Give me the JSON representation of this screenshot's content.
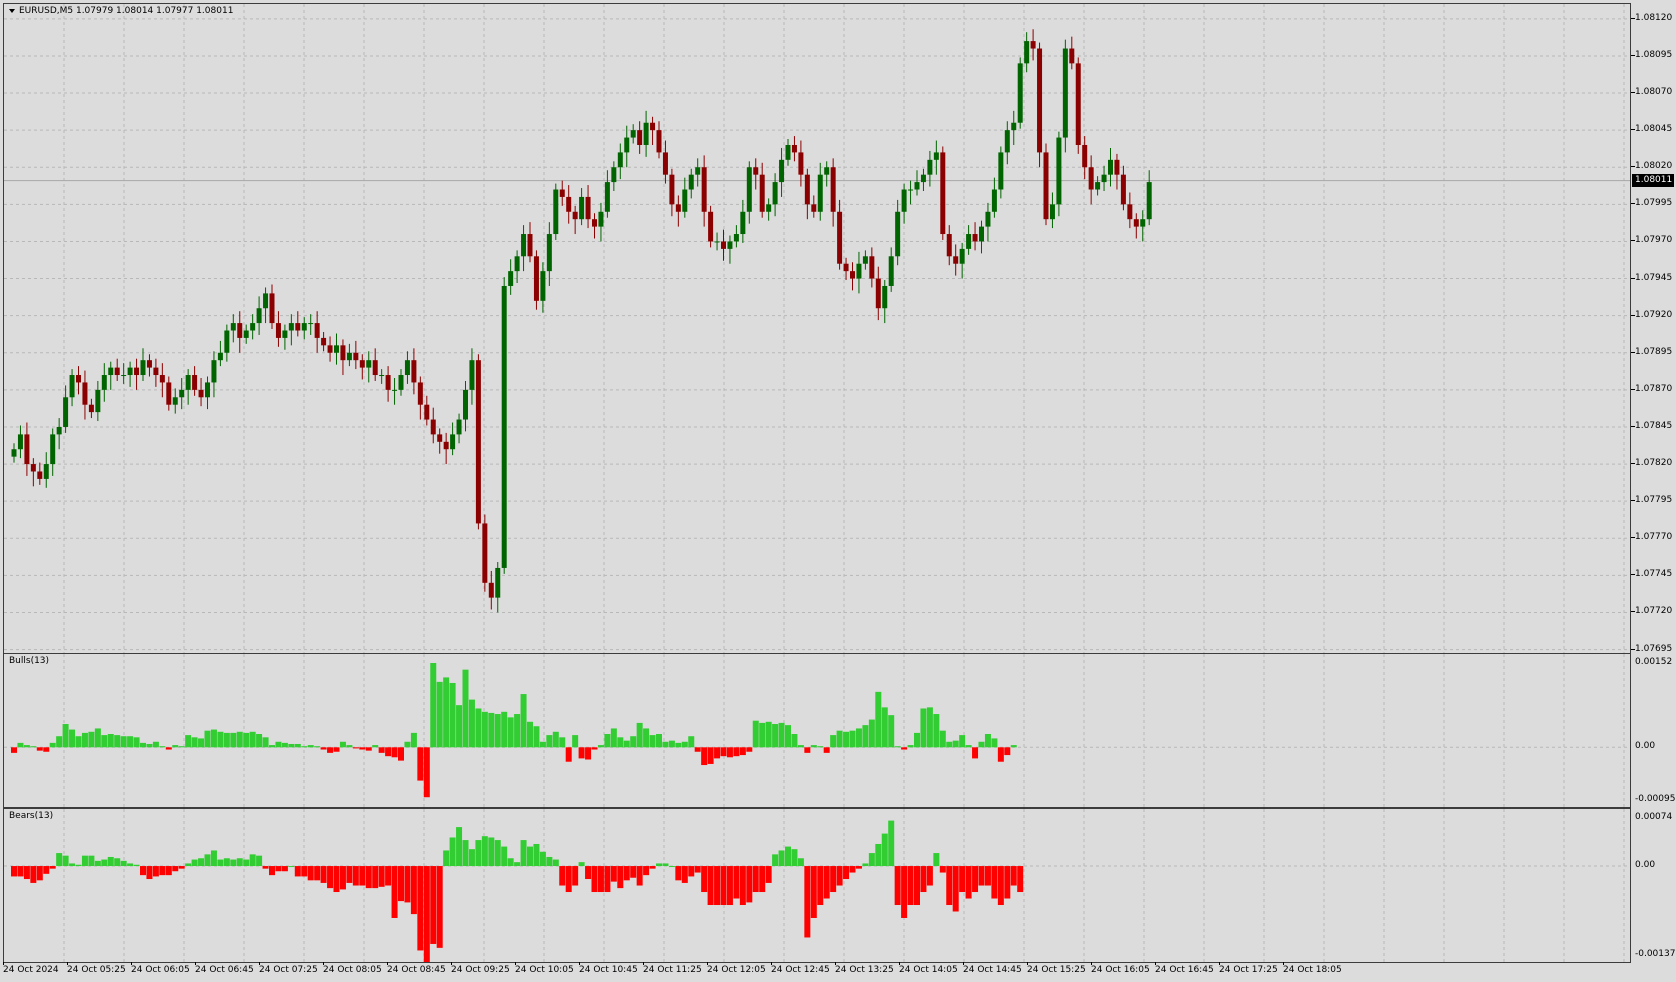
{
  "colors": {
    "background": "#dcdcdc",
    "grid": "#b8b8b8",
    "bull_candle": "#006400",
    "bear_candle": "#8b0000",
    "wick_up": "#006400",
    "wick_down": "#8b0000",
    "bulls_pos": "#32cd32",
    "bulls_neg": "#ff0000"
  },
  "main": {
    "title": "EURUSD,M5  1.07979 1.08014 1.07977 1.08011",
    "collapse_icon": "triangle-down-icon",
    "current_price": "1.08011",
    "price_ticks": [
      "1.08120",
      "1.08095",
      "1.08070",
      "1.08045",
      "1.08020",
      "1.07995",
      "1.07970",
      "1.07945",
      "1.07920",
      "1.07895",
      "1.07870",
      "1.07845",
      "1.07820",
      "1.07795",
      "1.07770",
      "1.07745",
      "1.07720",
      "1.07695"
    ]
  },
  "bulls": {
    "label": "Bulls(13)",
    "ticks": [
      "0.00152",
      "0.00",
      "-0.00095"
    ]
  },
  "bears": {
    "label": "Bears(13)",
    "ticks": [
      "0.00074",
      "0.00",
      "-0.00137"
    ]
  },
  "time_labels": [
    "24 Oct 2024",
    "24 Oct 05:25",
    "24 Oct 06:05",
    "24 Oct 06:45",
    "24 Oct 07:25",
    "24 Oct 08:05",
    "24 Oct 08:45",
    "24 Oct 09:25",
    "24 Oct 10:05",
    "24 Oct 10:45",
    "24 Oct 11:25",
    "24 Oct 12:05",
    "24 Oct 12:45",
    "24 Oct 13:25",
    "24 Oct 14:05",
    "24 Oct 14:45",
    "24 Oct 15:25",
    "24 Oct 16:05",
    "24 Oct 16:45",
    "24 Oct 17:25",
    "24 Oct 18:05"
  ],
  "chart_data": [
    {
      "type": "candlestick",
      "symbol": "EURUSD",
      "timeframe": "M5",
      "ylim": [
        1.0769,
        1.0813
      ],
      "closes": [
        1.0783,
        1.0784,
        1.0782,
        1.07815,
        1.0781,
        1.0782,
        1.0784,
        1.07845,
        1.07865,
        1.0788,
        1.07875,
        1.0786,
        1.07855,
        1.0787,
        1.0788,
        1.07885,
        1.0788,
        1.0788,
        1.07885,
        1.0788,
        1.0789,
        1.07885,
        1.0788,
        1.07875,
        1.0786,
        1.07865,
        1.0787,
        1.0788,
        1.0787,
        1.07865,
        1.07875,
        1.0789,
        1.07895,
        1.0791,
        1.07915,
        1.07905,
        1.0791,
        1.07915,
        1.07925,
        1.07935,
        1.07915,
        1.07905,
        1.0791,
        1.07915,
        1.0791,
        1.07915,
        1.07915,
        1.07905,
        1.079,
        1.07895,
        1.079,
        1.0789,
        1.07895,
        1.0789,
        1.07885,
        1.0789,
        1.0788,
        1.0788,
        1.0787,
        1.0787,
        1.0788,
        1.0789,
        1.07875,
        1.0786,
        1.0785,
        1.0784,
        1.07835,
        1.0783,
        1.0784,
        1.0785,
        1.0787,
        1.0789,
        1.0778,
        1.0774,
        1.0773,
        1.0775,
        1.0794,
        1.0795,
        1.0796,
        1.07975,
        1.0796,
        1.0793,
        1.0795,
        1.07975,
        1.08005,
        1.08,
        1.0799,
        1.07985,
        1.08,
        1.07985,
        1.0798,
        1.0799,
        1.0801,
        1.0802,
        1.0803,
        1.0804,
        1.08045,
        1.08035,
        1.0805,
        1.08045,
        1.0803,
        1.08015,
        1.07995,
        1.0799,
        1.08005,
        1.08015,
        1.0802,
        1.0799,
        1.0797,
        1.0797,
        1.07965,
        1.0797,
        1.07975,
        1.0799,
        1.0802,
        1.08015,
        1.0799,
        1.07995,
        1.0801,
        1.08025,
        1.08035,
        1.0803,
        1.08015,
        1.07995,
        1.0799,
        1.08015,
        1.0802,
        1.0799,
        1.07955,
        1.0795,
        1.07945,
        1.07955,
        1.0796,
        1.07945,
        1.07925,
        1.0794,
        1.0796,
        1.0799,
        1.08005,
        1.08005,
        1.0801,
        1.08015,
        1.08025,
        1.0803,
        1.07975,
        1.0796,
        1.07955,
        1.07965,
        1.07975,
        1.0797,
        1.0798,
        1.0799,
        1.08005,
        1.0803,
        1.08045,
        1.0805,
        1.0809,
        1.08105,
        1.081,
        1.0803,
        1.07985,
        1.07995,
        1.0804,
        1.081,
        1.0809,
        1.08035,
        1.0802,
        1.08005,
        1.0801,
        1.08015,
        1.08025,
        1.08015,
        1.07995,
        1.07985,
        1.0798,
        1.07985,
        1.0801
      ],
      "last_ohlc": {
        "open": 1.07979,
        "high": 1.08014,
        "low": 1.07977,
        "close": 1.08011
      }
    },
    {
      "type": "bar",
      "title": "Bulls(13)",
      "ylim": [
        -0.00095,
        0.00152
      ],
      "values": [
        -0.0001,
        8e-05,
        4e-05,
        2e-05,
        -6e-05,
        -8e-05,
        8e-05,
        0.0002,
        0.00042,
        0.00032,
        0.0002,
        0.00026,
        0.00028,
        0.00034,
        0.00022,
        0.00024,
        0.00022,
        0.0002,
        0.0002,
        0.00018,
        8e-05,
        6e-05,
        0.0001,
        2e-05,
        -4e-05,
        4e-05,
        2e-05,
        0.00022,
        0.00018,
        0.00016,
        0.0003,
        0.00032,
        0.00028,
        0.00026,
        0.00026,
        0.00028,
        0.00026,
        0.00028,
        0.00024,
        0.00018,
        4e-05,
        0.0001,
        8e-05,
        6e-05,
        6e-05,
        2e-05,
        4e-05,
        2e-05,
        -4e-05,
        -0.0001,
        -8e-05,
        0.0001,
        4e-05,
        -2e-05,
        -4e-05,
        -6e-05,
        4e-05,
        -0.0001,
        -0.00016,
        -0.00018,
        -0.00024,
        0.0001,
        0.00026,
        -0.0006,
        -0.0009,
        0.00152,
        0.00118,
        0.00126,
        0.00116,
        0.00076,
        0.0014,
        0.00086,
        0.0007,
        0.00064,
        0.00062,
        0.0006,
        0.00064,
        0.00054,
        0.0006,
        0.00096,
        0.00046,
        0.00038,
        0.0001,
        0.00022,
        0.00028,
        0.00018,
        -0.00026,
        0.00022,
        -0.0002,
        -0.00022,
        -4e-05,
        4e-05,
        0.00024,
        0.00034,
        0.00018,
        0.00012,
        0.0002,
        0.00044,
        0.00034,
        0.00022,
        0.00024,
        0.0001,
        0.00012,
        8e-05,
        0.0001,
        0.0002,
        -8e-05,
        -0.00032,
        -0.0003,
        -0.0002,
        -0.00016,
        -0.00018,
        -0.00016,
        -0.00014,
        -8e-05,
        0.00048,
        0.00044,
        0.00046,
        0.00042,
        0.00044,
        0.0004,
        0.00024,
        4e-05,
        -0.0001,
        4e-05,
        2e-05,
        -0.0001,
        0.00022,
        0.0003,
        0.00028,
        0.0003,
        0.00034,
        0.0004,
        0.0005,
        0.001,
        0.00072,
        0.00058,
        2e-05,
        -4e-05,
        4e-05,
        0.00026,
        0.0007,
        0.00072,
        0.0006,
        0.0003,
        0.0001,
        0.00012,
        0.00022,
        4e-05,
        -0.0002,
        0.0001,
        0.00024,
        0.00016,
        -0.00026,
        -0.00014,
        4e-05
      ],
      "neg_indices": [
        0,
        4,
        5,
        24,
        48,
        49,
        50,
        53,
        54,
        55,
        57,
        58,
        59,
        60,
        63,
        64,
        86,
        88,
        89,
        90,
        106,
        107,
        108,
        109,
        110,
        111,
        112,
        113,
        114,
        122,
        125,
        142,
        147,
        151,
        152,
        153
      ]
    },
    {
      "type": "bar",
      "title": "Bears(13)",
      "ylim": [
        -0.00137,
        0.00074
      ],
      "values": [
        -0.00016,
        -0.00016,
        -0.0002,
        -0.00026,
        -0.00022,
        -0.00012,
        -4e-05,
        0.0002,
        0.00016,
        4e-05,
        2e-05,
        0.00016,
        0.00016,
        8e-05,
        0.0001,
        0.00014,
        0.00012,
        8e-05,
        4e-05,
        2e-05,
        -0.00014,
        -0.0002,
        -0.00016,
        -0.00014,
        -0.00014,
        -8e-05,
        -4e-05,
        4e-05,
        0.0001,
        0.00012,
        0.00018,
        0.00024,
        0.0001,
        0.00012,
        0.0001,
        0.00012,
        0.0001,
        0.00018,
        0.00016,
        -4e-05,
        -0.00014,
        -8e-05,
        -8e-05,
        0.0,
        -0.00016,
        -0.00016,
        -0.00022,
        -0.00022,
        -0.00026,
        -0.00034,
        -0.0004,
        -0.00036,
        -0.00026,
        -0.0003,
        -0.0003,
        -0.00034,
        -0.00034,
        -0.00032,
        -0.0003,
        -0.0008,
        -0.00054,
        -0.00056,
        -0.00074,
        -0.0013,
        -0.00148,
        -0.0012,
        -0.00126,
        0.00024,
        0.00044,
        0.0006,
        0.0004,
        0.00026,
        0.0004,
        0.00046,
        0.00044,
        0.0004,
        0.0003,
        0.00012,
        6e-05,
        0.0004,
        0.0003,
        0.00034,
        0.00022,
        0.00014,
        0.0001,
        -0.0003,
        -0.0004,
        -0.0003,
        6e-05,
        -0.0002,
        -0.0004,
        -0.0004,
        -0.0004,
        -0.00024,
        -0.00034,
        -0.00022,
        -0.00018,
        -0.0003,
        -0.00014,
        -4e-05,
        4e-05,
        4e-05,
        0.0,
        -0.00022,
        -0.00026,
        -0.00016,
        -0.0001,
        -0.0004,
        -0.0006,
        -0.0006,
        -0.0006,
        -0.0006,
        -0.0005,
        -0.0006,
        -0.00056,
        -0.0004,
        -0.0004,
        -0.00026,
        0.00018,
        0.00024,
        0.0003,
        0.00026,
        0.00012,
        -0.0011,
        -0.0008,
        -0.0006,
        -0.0005,
        -0.0004,
        -0.0003,
        -0.0002,
        -0.0001,
        -4e-05,
        4e-05,
        0.0002,
        0.00034,
        0.0005,
        0.0007,
        -0.0006,
        -0.0008,
        -0.0006,
        -0.0006,
        -0.0004,
        -0.0003,
        0.0002,
        -0.0001,
        -0.0006,
        -0.0007,
        -0.0004,
        -0.0005,
        -0.0004,
        -0.0003,
        -0.0003,
        -0.0005,
        -0.0006,
        -0.0005,
        -0.0003,
        -0.0004
      ]
    }
  ]
}
